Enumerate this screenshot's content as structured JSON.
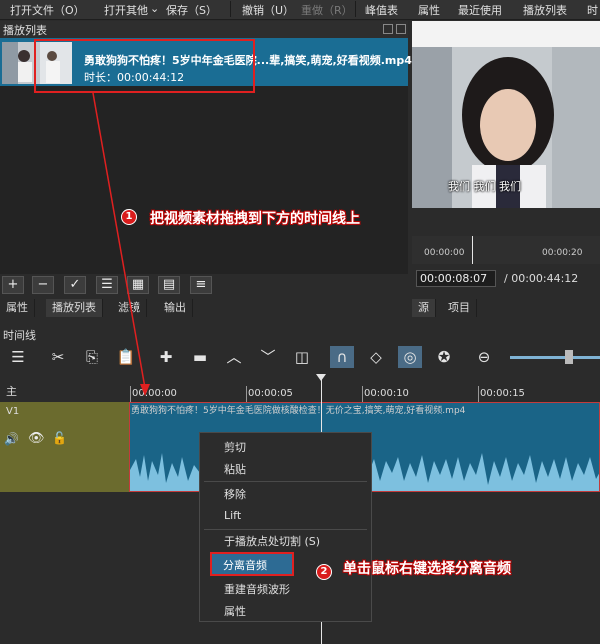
{
  "menubar": {
    "items": [
      "打开文件（O）",
      "打开其他",
      "保存（S）",
      "撤销（U）",
      "重做（R）",
      "峰值表",
      "属性",
      "最近使用",
      "播放列表",
      "时"
    ]
  },
  "playlist": {
    "title": "播放列表",
    "item_name": "勇敢狗狗不怕疼！5岁中年金毛医院...辈,搞笑,萌宠,好看视频.mp4",
    "item_duration": "时长：00:00:44:12",
    "toolbar_icons": [
      "+",
      "−",
      "✓",
      "☰",
      "▦",
      "▤",
      "≡"
    ]
  },
  "left_tabs": [
    "属性",
    "播放列表",
    "滤镜",
    "输出"
  ],
  "player": {
    "subtitle": "我们 我们 我们",
    "ruler_start": "00:00:00",
    "ruler_end": "00:00:20",
    "timecode": "00:00:08:07",
    "total": "/ 00:00:44:12",
    "tabs": [
      "源",
      "项目"
    ]
  },
  "timeline": {
    "title": "时间线",
    "main_label": "主",
    "track_label": "V1",
    "ruler_ticks": [
      "00:00:00",
      "00:00:05",
      "00:00:10",
      "00:00:15"
    ],
    "clip_name": "勇敢狗狗不怕疼！5岁中年金毛医院做核酸检查！无价之宝,搞笑,萌宠,好看视频.mp4"
  },
  "context_menu": {
    "items": [
      "剪切",
      "粘贴",
      "移除",
      "Lift",
      "于播放点处切割 (S)",
      "分离音频",
      "重建音频波形",
      "属性"
    ]
  },
  "annotations": {
    "step1_num": "1",
    "step1_text": "把视频素材拖拽到下方的时间线上",
    "step2_num": "2",
    "step2_text": "单击鼠标右键选择分离音频"
  },
  "colors": {
    "accent": "#1a6d94",
    "annotation": "#d91c1c",
    "track_head": "#6b6b2e"
  }
}
